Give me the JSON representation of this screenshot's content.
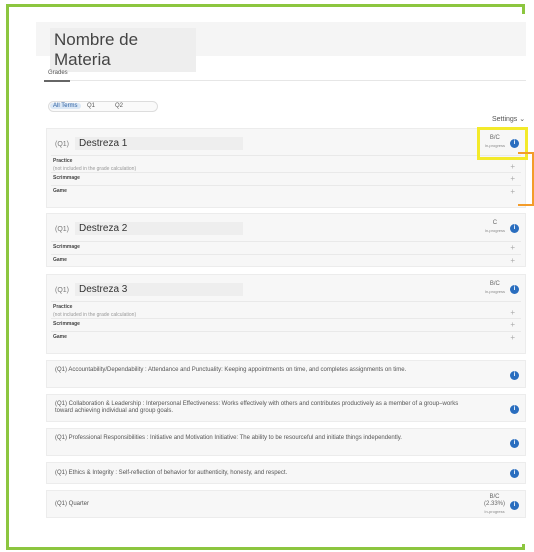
{
  "course": {
    "title": "Nombre de Materia"
  },
  "tabs": {
    "grades": "Grades"
  },
  "terms": [
    "All Terms",
    "Q1",
    "Q2"
  ],
  "settings": "Settings",
  "skills": [
    {
      "code": "(Q1)",
      "name": "Destreza 1",
      "grade": "B/C",
      "status": "In-progress",
      "rows": [
        {
          "label": "Practice",
          "note": "(not included in the grade calculation)"
        },
        {
          "label": "Scrimmage"
        },
        {
          "label": "Game"
        }
      ]
    },
    {
      "code": "(Q1)",
      "name": "Destreza 2",
      "grade": "C",
      "status": "In-progress",
      "rows": [
        {
          "label": "Scrimmage"
        },
        {
          "label": "Game"
        }
      ]
    },
    {
      "code": "(Q1)",
      "name": "Destreza 3",
      "grade": "B/C",
      "status": "In-progress",
      "rows": [
        {
          "label": "Practice",
          "note": "(not included in the grade calculation)"
        },
        {
          "label": "Scrimmage"
        },
        {
          "label": "Game"
        }
      ]
    }
  ],
  "standards": [
    "(Q1) Accountability/Dependability : Attendance and Punctuality: Keeping appointments on time, and completes assignments on time.",
    "(Q1) Collaboration & Leadership : Interpersonal Effectiveness: Works effectively with others and contributes productively as a member of a group–works toward achieving individual and group goals.",
    "(Q1) Professional Responsibilities : Initiative and Motivation Initiative: The ability to be resourceful and initiate things independently.",
    "(Q1) Ethics & Integrity : Self-reflection of behavior for authenticity, honesty, and respect."
  ],
  "quarter": {
    "label": "(Q1) Quarter",
    "grade": "B/C",
    "percent": "(2.33%)",
    "status": "In-progress"
  },
  "icons": {
    "info": "info-icon",
    "plus": "plus-icon",
    "chevron": "chevron-down-icon"
  },
  "colors": {
    "frame": "#8cc63f",
    "highlight": "#f3ea2a",
    "bracket": "#f39c2a",
    "info": "#2a6ebf"
  }
}
